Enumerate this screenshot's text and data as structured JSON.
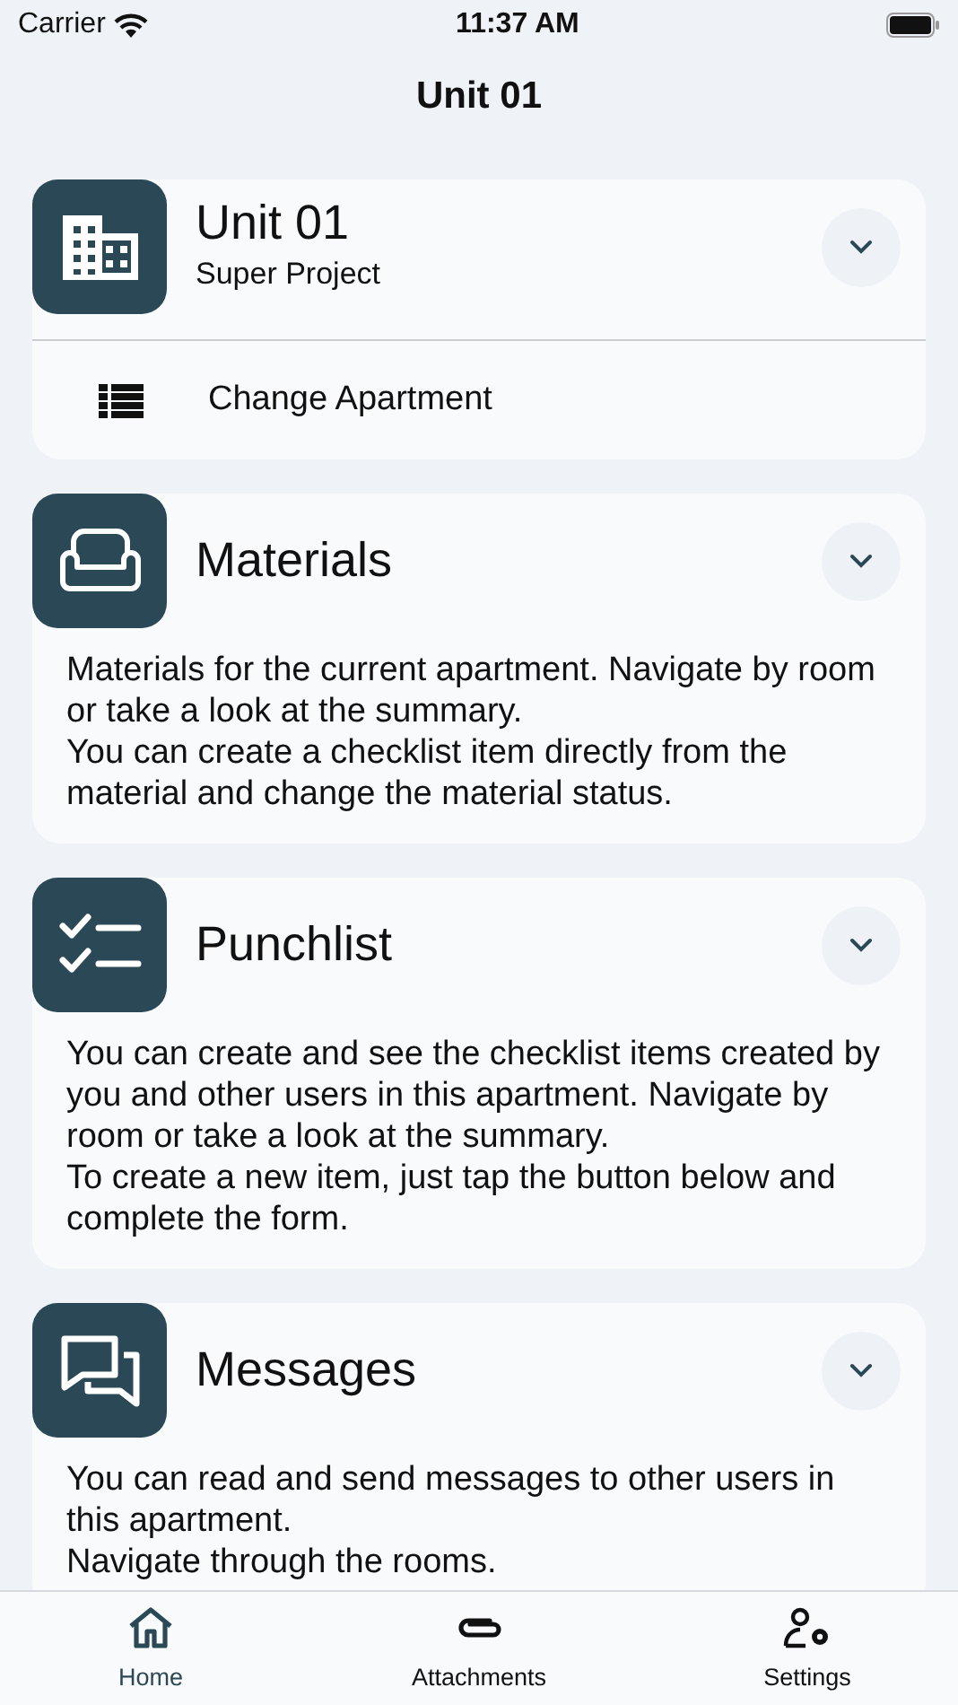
{
  "status_bar": {
    "carrier": "Carrier",
    "time": "11:37 AM"
  },
  "title": "Unit 01",
  "unit_card": {
    "title": "Unit 01",
    "subtitle": "Super Project",
    "expanded": false,
    "action": "Change Apartment"
  },
  "sections": [
    {
      "kind": "materials",
      "title": "Materials",
      "expanded": false,
      "paragraphs": [
        "Materials for the current apartment. Navigate by room or take a look at the summary.",
        "You can create a checklist item directly from the material and change the material status."
      ]
    },
    {
      "kind": "punchlist",
      "title": "Punchlist",
      "expanded": false,
      "paragraphs": [
        "You can create and see the checklist items created by you and other users in this apartment. Navigate by room or take a look at the summary.",
        "To create a new item, just tap the button below and complete the form."
      ]
    },
    {
      "kind": "messages",
      "title": "Messages",
      "expanded": false,
      "paragraphs": [
        "You can read and send messages to other users in this apartment.",
        "Navigate through the rooms."
      ]
    }
  ],
  "tab_bar": [
    {
      "kind": "home",
      "label": "Home",
      "selected": true
    },
    {
      "kind": "attachments",
      "label": "Attachments",
      "selected": false
    },
    {
      "kind": "settings",
      "label": "Settings",
      "selected": false
    }
  ]
}
